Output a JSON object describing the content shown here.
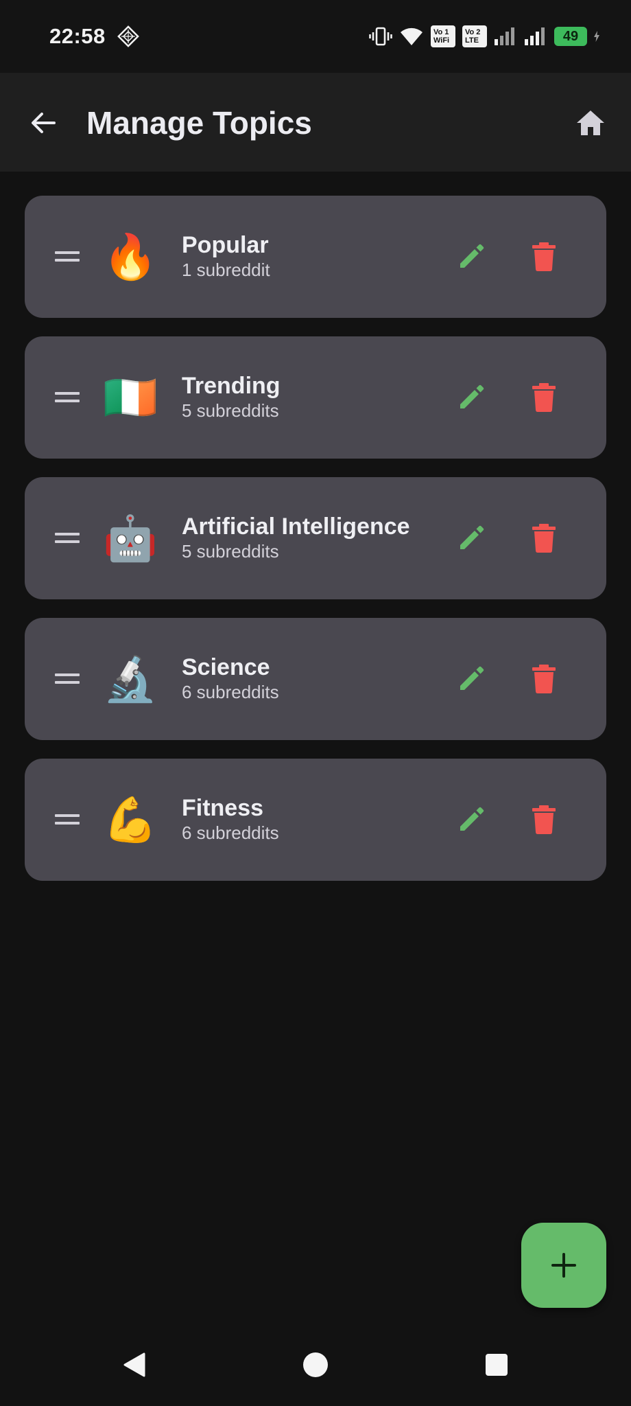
{
  "status_bar": {
    "time": "22:58",
    "left_icon": "diamond-grid-icon",
    "icons": [
      "vibrate-icon",
      "wifi-icon",
      "volte-wifi-badge",
      "volte-lte-badge",
      "signal-1-icon",
      "signal-2-icon"
    ],
    "volte1": {
      "line1": "Vo 1",
      "line2": "WiFi"
    },
    "volte2": {
      "line1": "Vo 2",
      "line2": "LTE"
    },
    "battery": "49",
    "battery_color": "#3dbb5c"
  },
  "app_bar": {
    "title": "Manage Topics",
    "back_icon": "arrow-left-icon",
    "home_icon": "home-icon"
  },
  "topics": [
    {
      "emoji": "🔥",
      "name": "Popular",
      "count": "1 subreddit"
    },
    {
      "emoji": "🇮🇪",
      "name": "Trending",
      "count": "5 subreddits"
    },
    {
      "emoji": "🤖",
      "name": "Artificial Intelligence",
      "count": "5 subreddits"
    },
    {
      "emoji": "🔬",
      "name": "Science",
      "count": "6 subreddits"
    },
    {
      "emoji": "💪",
      "name": "Fitness",
      "count": "6 subreddits"
    }
  ],
  "colors": {
    "background": "#121212",
    "app_bar": "#1f1f1f",
    "card": "#4a4850",
    "edit_icon": "#65bb6a",
    "delete_icon": "#f25450",
    "fab": "#65bb6a"
  },
  "fab": {
    "icon": "plus-icon"
  },
  "nav_bar": {
    "icons": [
      "nav-back-icon",
      "nav-home-icon",
      "nav-recents-icon"
    ]
  }
}
